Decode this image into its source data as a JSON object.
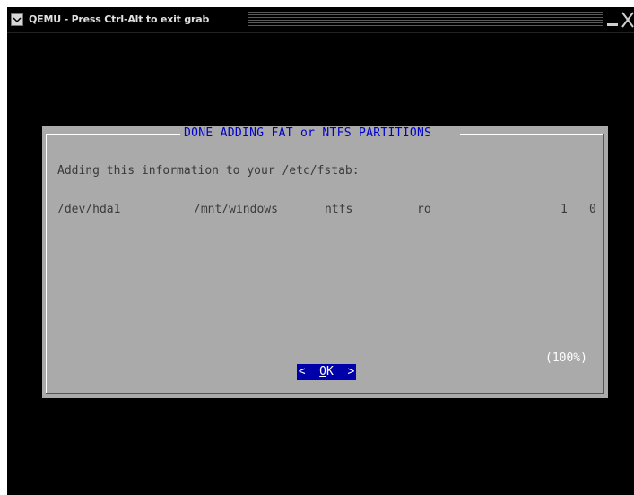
{
  "window": {
    "title": "QEMU - Press Ctrl-Alt to exit grab"
  },
  "dialog": {
    "title": "DONE ADDING FAT or NTFS PARTITIONS",
    "message": "Adding this information to your /etc/fstab:",
    "fstab_entry": {
      "device": "/dev/hda1",
      "mount_point": "/mnt/windows",
      "fs_type": "ntfs",
      "options": "ro",
      "dump": "1",
      "pass": "0"
    },
    "scroll_percent": "(100%)",
    "ok_button": {
      "left": "<",
      "hotkey": "O",
      "rest": "K",
      "right": ">"
    }
  },
  "colors": {
    "screen_bg": "#000000",
    "dialog_bg": "#aaaaaa",
    "title_fg": "#0000cc",
    "body_fg": "#3a3a3a",
    "button_bg": "#0000aa",
    "button_fg": "#ffffff"
  }
}
